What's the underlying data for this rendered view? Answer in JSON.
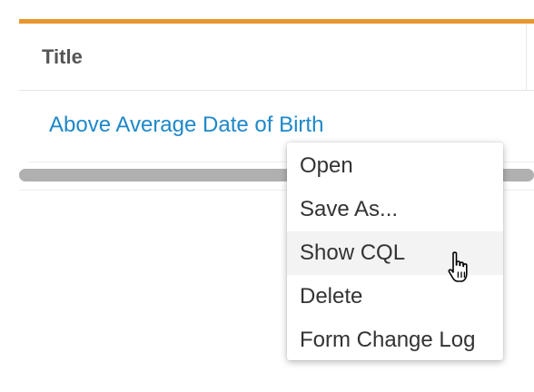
{
  "table": {
    "header_title": "Title",
    "rows": [
      {
        "title": "Above Average Date of Birth"
      }
    ]
  },
  "context_menu": {
    "items": [
      {
        "label": "Open",
        "hovered": false
      },
      {
        "label": "Save As...",
        "hovered": false
      },
      {
        "label": "Show CQL",
        "hovered": true
      },
      {
        "label": "Delete",
        "hovered": false
      },
      {
        "label": "Form Change Log",
        "hovered": false
      }
    ]
  },
  "colors": {
    "accent": "#e8962e",
    "link": "#1e88c8",
    "hover_bg": "#f3f3f3"
  },
  "icons": {
    "cursor": "hand-pointer-icon"
  }
}
